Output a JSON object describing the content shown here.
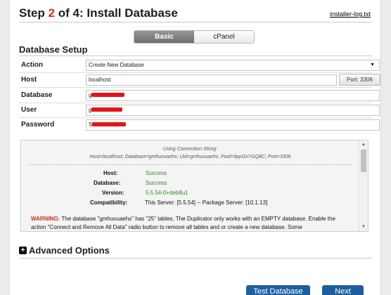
{
  "header": {
    "title_prefix": "Step ",
    "step": "2",
    "title_suffix": " of 4: Install Database",
    "log_link": "installer-log.txt"
  },
  "modes": {
    "basic": "Basic",
    "cpanel": "cPanel",
    "selected": "Basic"
  },
  "setup": {
    "title": "Database Setup",
    "action": {
      "label": "Action",
      "value": "Create New Database"
    },
    "host": {
      "label": "Host",
      "value": "localhost",
      "port_button": "Port: 3306"
    },
    "database": {
      "label": "Database",
      "value": "g"
    },
    "user": {
      "label": "User",
      "value": "g"
    },
    "password": {
      "label": "Password",
      "value": "S"
    }
  },
  "results": {
    "using": "Using Connection String:",
    "connection": "Host=localhost; Database=gmhuvuaehs; Uid=gmhuvuaehs; Pwd=9ppGxYGQ8C; Port=3306",
    "host_k": "Host:",
    "host_v": "Success",
    "database_k": "Database:",
    "database_v": "Success",
    "version_k": "Version:",
    "version_v": "5.5.54-0+deb8u1",
    "compat_k": "Compatibility:",
    "compat_v": "This Server: [5.5.54] -- Package Server: [10.1.13]",
    "warning_label": "WARNING:",
    "warning_text": " The database \"gmhuvuaehs\" has \"25\" tables. The Duplicator only works with an EMPTY database. Enable the action \"Connect and Remove All Data\" radio button to remove all tables and or create a new database. Some"
  },
  "advanced": {
    "label": "Advanced Options"
  },
  "buttons": {
    "test": "Test Database",
    "next": "Next"
  },
  "colors": {
    "accent": "#1d5f9e",
    "step": "#c8361f",
    "success": "#2e8b1f",
    "redaction": "#e2141c"
  }
}
